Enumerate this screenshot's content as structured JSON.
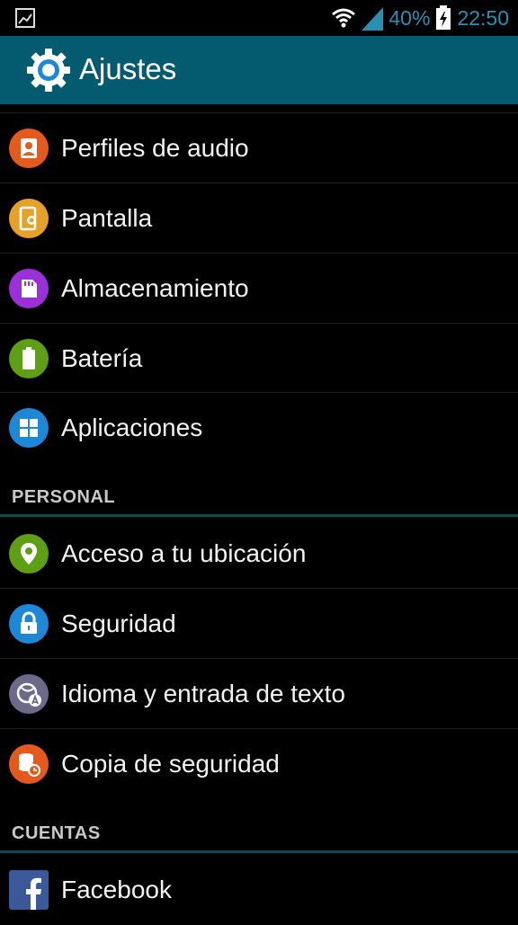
{
  "status_bar": {
    "battery_percent": "40%",
    "time": "22:50",
    "icons": [
      "gallery-icon",
      "wifi-icon",
      "signal-icon",
      "battery-icon"
    ]
  },
  "action_bar": {
    "title": "Ajustes",
    "icon": "gear-icon"
  },
  "device_items": [
    {
      "label": "Perfiles de audio",
      "icon": "audio-profile-icon",
      "color": "#e35a1c"
    },
    {
      "label": "Pantalla",
      "icon": "display-icon",
      "color": "#e6a228"
    },
    {
      "label": "Almacenamiento",
      "icon": "storage-icon",
      "color": "#9b2fd8"
    },
    {
      "label": "Batería",
      "icon": "battery-icon",
      "color": "#5f9f16"
    },
    {
      "label": "Aplicaciones",
      "icon": "apps-icon",
      "color": "#1f88d6"
    }
  ],
  "sections": {
    "personal": "PERSONAL",
    "cuentas": "CUENTAS"
  },
  "personal_items": [
    {
      "label": "Acceso a tu ubicación",
      "icon": "location-icon",
      "color": "#5f9f16"
    },
    {
      "label": "Seguridad",
      "icon": "lock-icon",
      "color": "#1f88d6"
    },
    {
      "label": "Idioma y entrada de texto",
      "icon": "language-icon",
      "color": "#6d6a89"
    },
    {
      "label": "Copia de seguridad",
      "icon": "backup-icon",
      "color": "#e35a1c"
    }
  ],
  "account_items": [
    {
      "label": "Facebook",
      "icon": "facebook-icon",
      "color": "#3b5998"
    }
  ]
}
